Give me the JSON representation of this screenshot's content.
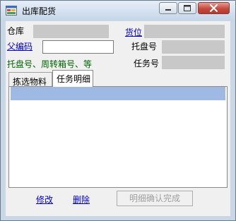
{
  "window": {
    "title": "出库配货"
  },
  "form": {
    "warehouse_label": "仓库",
    "warehouse_value": "",
    "location_link": "货位",
    "location_value": "",
    "parent_code_link": "父编码",
    "parent_code_value": "",
    "pallet_label": "托盘号",
    "pallet_value": "",
    "hint": "托盘号、周转箱号、等",
    "task_label": "任务号",
    "task_value": ""
  },
  "tabs": [
    {
      "label": "拣选物料",
      "active": false
    },
    {
      "label": "任务明细",
      "active": true
    }
  ],
  "actions": {
    "edit_link": "修改",
    "delete_link": "删除",
    "confirm_button": "明细确认完成"
  },
  "colors": {
    "link": "#0000cc",
    "hint": "#006400",
    "grid_header": "#9db9e4",
    "close_button": "#c44a3d"
  },
  "icons": [
    "app-icon",
    "minimize-icon",
    "maximize-icon",
    "close-icon"
  ]
}
